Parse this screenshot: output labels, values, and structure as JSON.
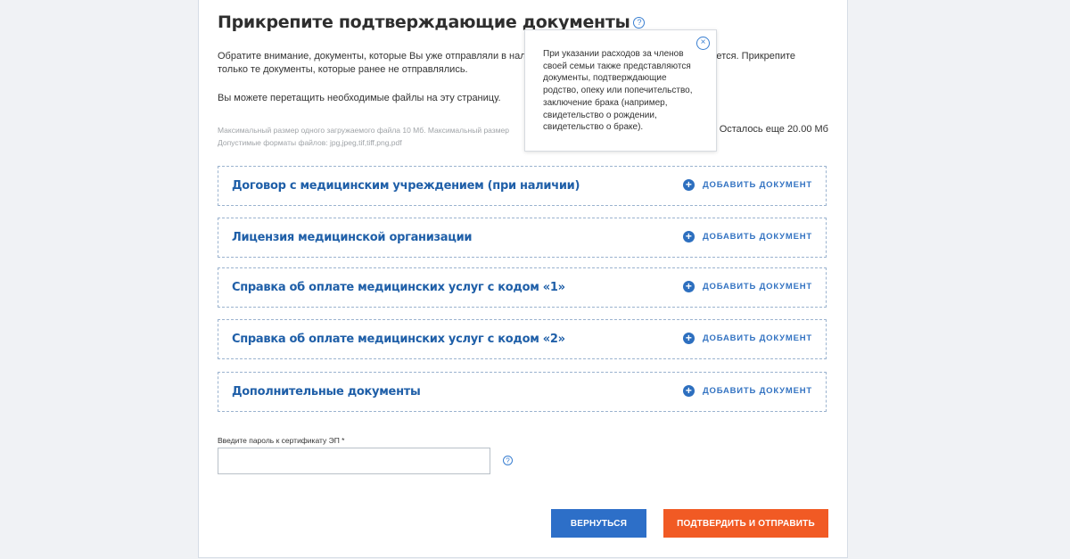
{
  "page": {
    "title": "Прикрепите подтверждающие документы",
    "help_glyph": "?"
  },
  "notice": {
    "line1_left": "Обратите внимание, документы, которые Вы уже отправляли в налогову",
    "line1_right": "буется. Прикрепите",
    "line2": "только те документы, которые ранее не отправлялись."
  },
  "drag_hint": "Вы можете перетащить необходимые файлы на эту страницу.",
  "limits": {
    "line1": "Максимальный размер одного загружаемого файла 10 Мб. Максимальный размер",
    "line2": "Допустимые форматы файлов: jpg,jpeg,tif,tiff,png,pdf",
    "remaining": "Осталось еще 20.00 Мб"
  },
  "documents": [
    {
      "title": "Договор с медицинским учреждением (при наличии)",
      "action": "ДОБАВИТЬ ДОКУМЕНТ"
    },
    {
      "title": "Лицензия медицинской организации",
      "action": "ДОБАВИТЬ ДОКУМЕНТ"
    },
    {
      "title": "Справка об оплате медицинских услуг с кодом «1»",
      "action": "ДОБАВИТЬ ДОКУМЕНТ"
    },
    {
      "title": "Справка об оплате медицинских услуг с кодом «2»",
      "action": "ДОБАВИТЬ ДОКУМЕНТ"
    },
    {
      "title": "Дополнительные документы",
      "action": "ДОБАВИТЬ ДОКУМЕНТ"
    }
  ],
  "password": {
    "label": "Введите пароль к сертификату ЭП *",
    "value": ""
  },
  "buttons": {
    "back": "ВЕРНУТЬСЯ",
    "submit": "ПОДТВЕРДИТЬ И ОТПРАВИТЬ"
  },
  "tooltip": {
    "text": "При указании расходов за членов своей семьи также представляются документы, подтверждающие родство, опеку или попечительство, заключение брака (например, свидетельство о рождении, свидетельство о браке).",
    "close_glyph": "×"
  },
  "icons": {
    "title_help": "question-circle-icon",
    "add": "plus-circle-icon",
    "password_help": "question-circle-icon",
    "tooltip_close": "close-circle-icon"
  },
  "colors": {
    "background": "#f0f2f5",
    "doc_title": "#1f5fa8",
    "accent_blue": "#2d6fc8",
    "accent_orange": "#f15a24",
    "dashed_border": "#9bb3cf"
  }
}
